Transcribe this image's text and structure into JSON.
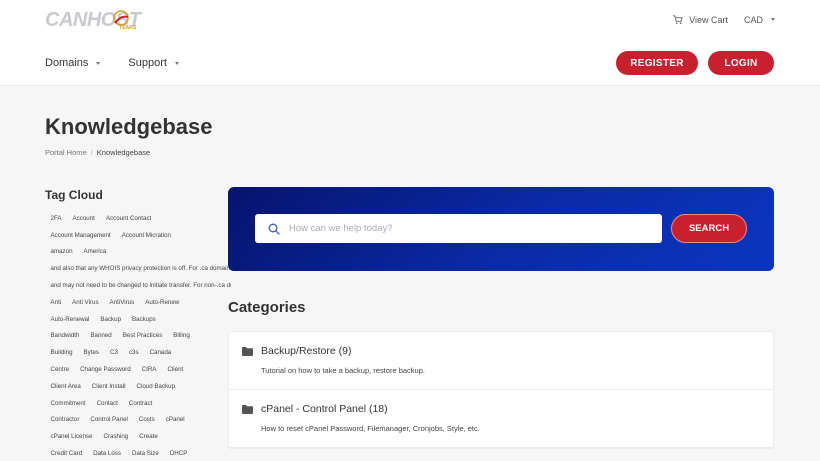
{
  "header": {
    "logo_text": "CANHOST",
    "logo_years": "YEARS",
    "view_cart": "View Cart",
    "currency": "CAD",
    "nav": [
      {
        "label": "Domains"
      },
      {
        "label": "Support"
      }
    ],
    "register_label": "REGISTER",
    "login_label": "LOGIN"
  },
  "page": {
    "title": "Knowledgebase",
    "breadcrumb": {
      "home": "Portal Home",
      "current": "Knowledgebase"
    }
  },
  "tag_cloud": {
    "title": "Tag Cloud",
    "rows": [
      [
        "2FA",
        "Account",
        "Account Contact"
      ],
      [
        "Account Management",
        "Account Micration"
      ],
      [
        "amazon",
        "America"
      ],
      [
        "and also that any WHOIS privacy protection is off. For .ca domains"
      ],
      [
        "and may not need to be changed to initiate transfer. For non-.ca domains"
      ],
      [
        "Anti",
        "Anti Virus",
        "AntiVirus",
        "Auto-Renew"
      ],
      [
        "Auto-Renewal",
        "Backup",
        "Backups"
      ],
      [
        "Bandwidth",
        "Banned",
        "Best Practices",
        "Billing"
      ],
      [
        "Building",
        "Bytes",
        "C3",
        "c3s",
        "Canada"
      ],
      [
        "Centre",
        "Change Password",
        "CIRA",
        "Client"
      ],
      [
        "Client Area",
        "Client Install",
        "Cloud Backup"
      ],
      [
        "Commitment",
        "Contact",
        "Contract"
      ],
      [
        "Contractor",
        "Control Panel",
        "Costs",
        "cPanel"
      ],
      [
        "cPanel License",
        "Crashing",
        "Create"
      ],
      [
        "Credit Card",
        "Data Loss",
        "Data Size",
        "DHCP"
      ]
    ]
  },
  "search": {
    "placeholder": "How can we help today?",
    "button_label": "SEARCH"
  },
  "categories": {
    "title": "Categories",
    "items": [
      {
        "name": "Backup/Restore (9)",
        "description": "Tutorial on how to take a backup, restore backup."
      },
      {
        "name": "cPanel - Control Panel (18)",
        "description": "How to reset cPanel Password, Filemanager, Cronjobs, Style, etc."
      }
    ]
  },
  "colors": {
    "accent_red": "#c8202e",
    "panel_blue": "#0a2ba8"
  }
}
